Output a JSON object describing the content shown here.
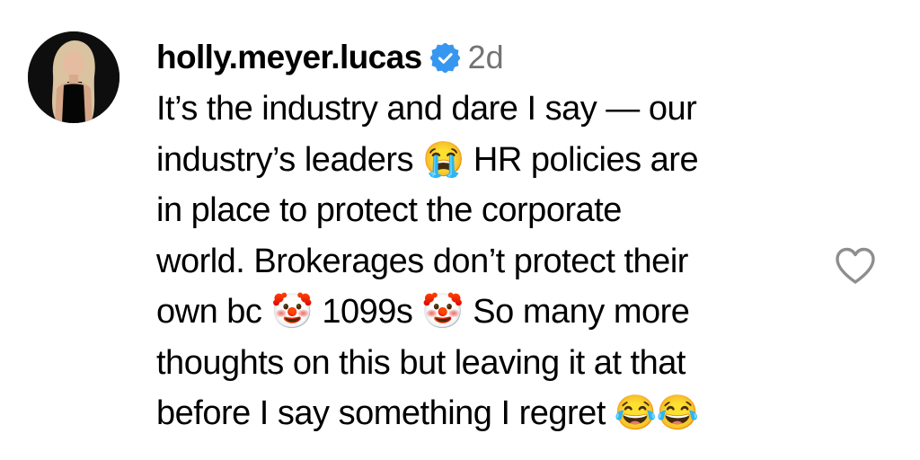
{
  "comment": {
    "username": "holly.meyer.lucas",
    "verified_icon": "verified-badge-icon",
    "timestamp": "2d",
    "lines": [
      "It’s the industry and dare I say — our",
      "industry’s leaders 😭 HR policies are",
      "in place to protect the corporate",
      "world. Brokerages don’t protect their",
      "own bc 🤡 1099s 🤡 So many more",
      "thoughts on this but leaving it at that",
      "before I say something I regret 😂😂"
    ],
    "like_icon": "heart-outline-icon",
    "avatar_icon": "profile-photo",
    "colors": {
      "verified": "#3797F0",
      "timestamp": "#737373",
      "heart_stroke": "#8E8E8E",
      "text": "#000000"
    }
  }
}
